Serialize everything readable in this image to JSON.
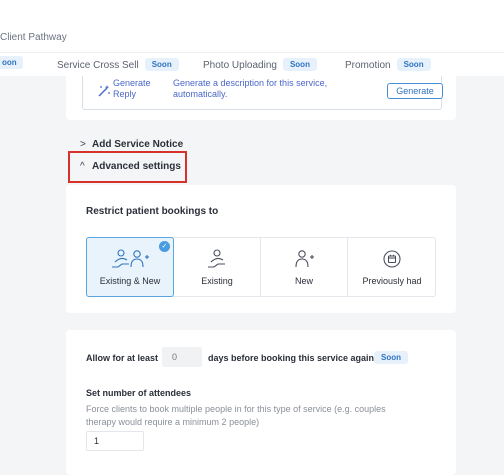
{
  "breadcrumb": {
    "current": "Client Pathway"
  },
  "tabs": {
    "edge_badge": "oon",
    "items": [
      {
        "label": "Service Cross Sell",
        "badge": "Soon"
      },
      {
        "label": "Photo Uploading",
        "badge": "Soon"
      },
      {
        "label": "Promotion",
        "badge": "Soon"
      }
    ]
  },
  "generate_reply": {
    "label": "Generate Reply",
    "description": "Generate a description for this service, automatically.",
    "button_label": "Generate",
    "icon": "magic-wand-icon"
  },
  "sections": {
    "service_notice": {
      "label": "Add Service Notice",
      "chevron": ">"
    },
    "advanced_settings": {
      "label": "Advanced settings",
      "chevron": "^",
      "highlight_color": "#d5322b"
    }
  },
  "restrict": {
    "title": "Restrict patient bookings to",
    "options": [
      {
        "label": "Existing & New",
        "icon": "existing-and-new-icon",
        "selected": true
      },
      {
        "label": "Existing",
        "icon": "existing-client-icon",
        "selected": false
      },
      {
        "label": "New",
        "icon": "new-client-icon",
        "selected": false
      },
      {
        "label": "Previously had",
        "icon": "calendar-history-icon",
        "selected": false
      }
    ]
  },
  "rebooking": {
    "prefix": "Allow for at least",
    "days_placeholder": "0",
    "suffix": "days before booking this service again",
    "badge": "Soon"
  },
  "attendees": {
    "title": "Set number of attendees",
    "description": "Force clients to book multiple people in for this type of service (e.g. couples therapy would require a minimum 2 people)",
    "value": "1"
  },
  "colors": {
    "accent": "#4a9be0",
    "badge_bg": "#e7f1fb",
    "badge_text": "#2f74c0",
    "link": "#4a67c7"
  }
}
